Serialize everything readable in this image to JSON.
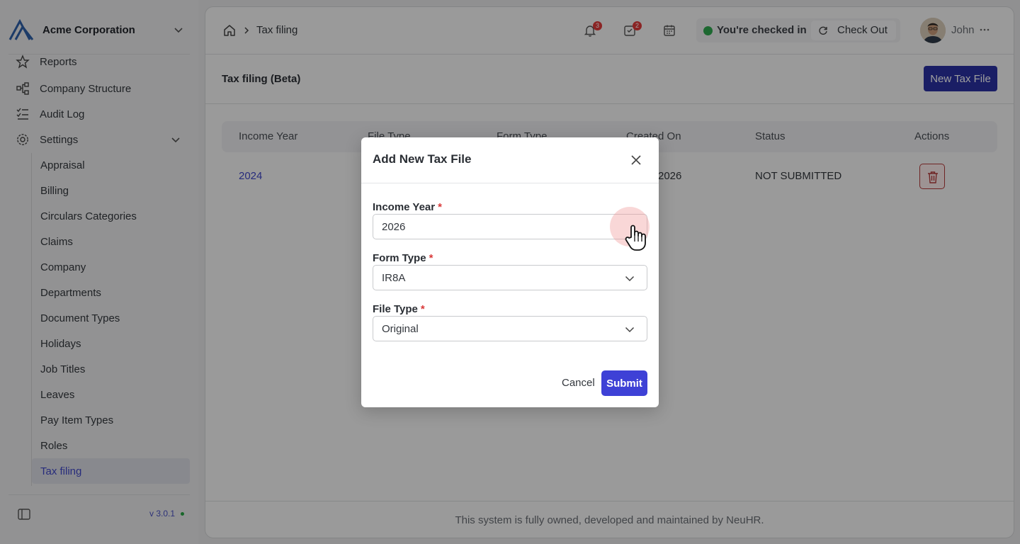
{
  "org": {
    "name": "Acme Corporation"
  },
  "sidebar": {
    "partial_item": "Reports",
    "items": [
      {
        "label": "Company Structure",
        "icon": "hierarchy-icon"
      },
      {
        "label": "Audit Log",
        "icon": "checklist-icon"
      },
      {
        "label": "Settings",
        "icon": "gear-icon"
      }
    ],
    "settings_items": [
      "Appraisal",
      "Billing",
      "Circulars Categories",
      "Claims",
      "Company",
      "Departments",
      "Document Types",
      "Holidays",
      "Job Titles",
      "Leaves",
      "Pay Item Types",
      "Roles",
      "Tax filing"
    ],
    "active_item": "Tax filing",
    "version": "v 3.0.1"
  },
  "topbar": {
    "breadcrumb": "Tax filing",
    "notifications_count": "3",
    "tasks_count": "2",
    "checkin_status": "You're checked in",
    "checkout_label": "Check Out",
    "user_name": "John"
  },
  "page": {
    "title": "Tax filing (Beta)",
    "new_button": "New Tax File"
  },
  "table": {
    "headers": [
      "Income Year",
      "File Type",
      "Form Type",
      "Created On",
      "Status",
      "Actions"
    ],
    "rows": [
      {
        "income_year": "2024",
        "created_on_partial": "2026",
        "status": "NOT SUBMITTED"
      }
    ]
  },
  "footer": {
    "text": "This system is fully owned, developed and maintained by NeuHR."
  },
  "modal": {
    "title": "Add New Tax File",
    "fields": [
      {
        "label": "Income Year",
        "required": "*",
        "value": "2026"
      },
      {
        "label": "Form Type",
        "required": "*",
        "value": "IR8A"
      },
      {
        "label": "File Type",
        "required": "*",
        "value": "Original"
      }
    ],
    "cancel_label": "Cancel",
    "submit_label": "Submit"
  },
  "colors": {
    "primary": "#2b31a4",
    "submit": "#3e41d6",
    "danger": "#b43a3a",
    "success": "#2fa84f",
    "link": "#4048c8"
  }
}
